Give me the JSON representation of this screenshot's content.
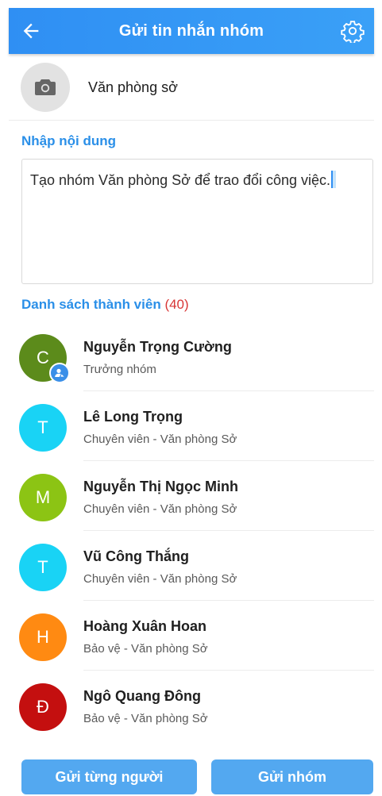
{
  "header": {
    "title": "Gửi tin nhắn nhóm",
    "back_icon": "arrow-left-icon",
    "settings_icon": "gear-icon"
  },
  "group": {
    "name": "Văn phòng sở",
    "avatar_icon": "camera-icon"
  },
  "content": {
    "label": "Nhập nội dung",
    "value": "Tạo nhóm Văn phòng Sở để trao đổi công việc."
  },
  "members": {
    "label": "Danh sách thành viên",
    "count": "(40)",
    "items": [
      {
        "initial": "C",
        "name": "Nguyễn Trọng Cường",
        "role": "Trưởng nhóm",
        "color": "#5c8b1b",
        "leader": true
      },
      {
        "initial": "T",
        "name": "Lê Long Trọng",
        "role": "Chuyên viên - Văn phòng Sở",
        "color": "#19d3f5",
        "leader": false
      },
      {
        "initial": "M",
        "name": "Nguyễn Thị Ngọc Minh",
        "role": "Chuyên viên - Văn phòng Sở",
        "color": "#8cc414",
        "leader": false
      },
      {
        "initial": "T",
        "name": "Vũ Công Thắng",
        "role": "Chuyên viên - Văn phòng Sở",
        "color": "#19d3f5",
        "leader": false
      },
      {
        "initial": "H",
        "name": "Hoàng Xuân Hoan",
        "role": "Bảo vệ - Văn phòng Sở",
        "color": "#ff8a12",
        "leader": false
      },
      {
        "initial": "Đ",
        "name": "Ngô Quang Đông",
        "role": "Bảo vệ - Văn phòng Sở",
        "color": "#c40f0f",
        "leader": false
      }
    ]
  },
  "actions": {
    "send_individual": "Gửi từng người",
    "send_group": "Gửi nhóm"
  },
  "colors": {
    "primary": "#2f8ff3",
    "button": "#53a8f0",
    "count": "#d83636"
  }
}
